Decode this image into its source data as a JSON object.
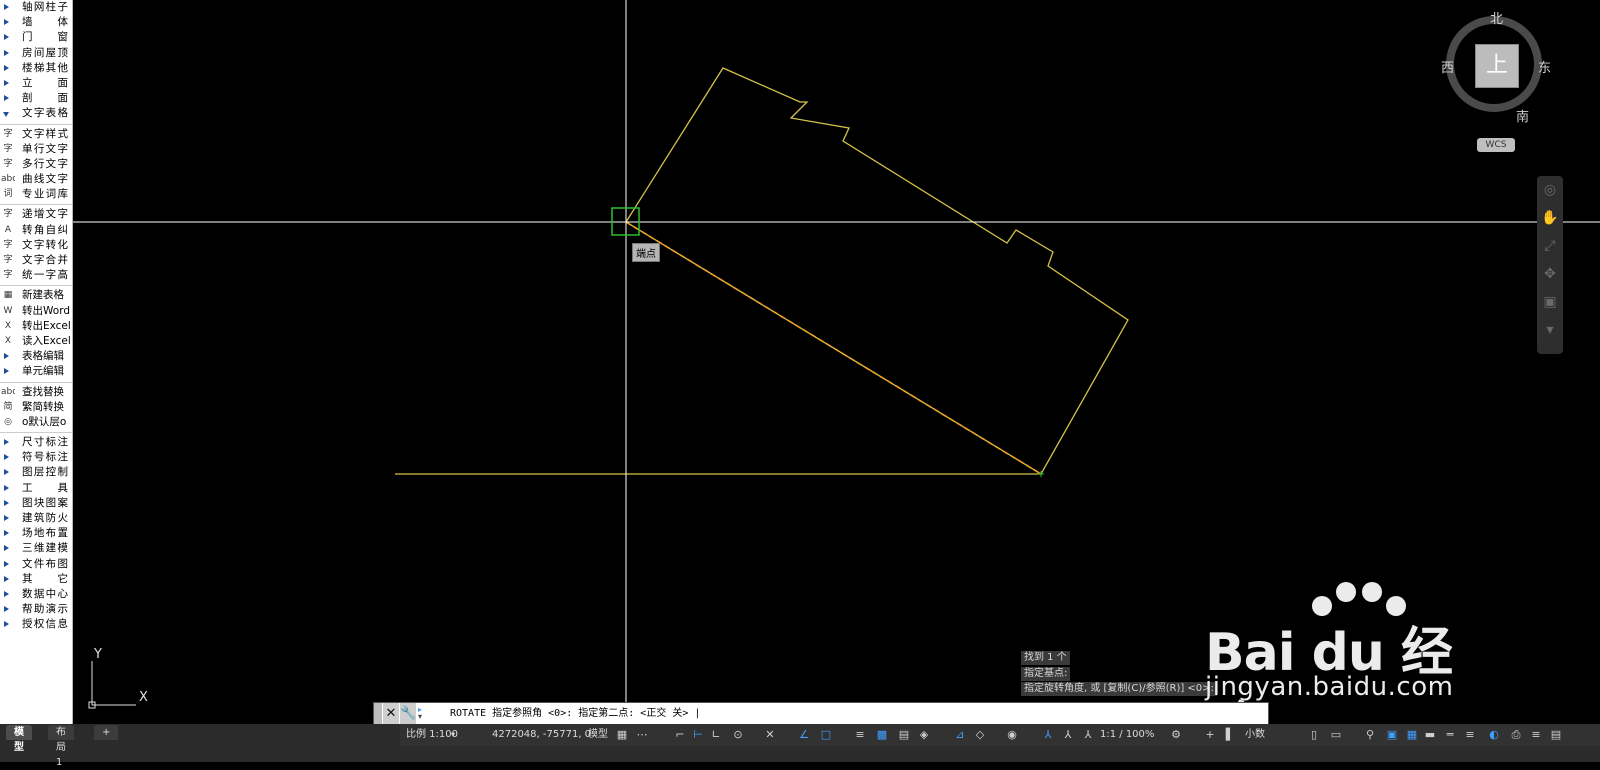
{
  "sidebar": {
    "groups_top": [
      {
        "label": "轴网柱子",
        "state": "closed"
      },
      {
        "label": "墙　体",
        "state": "closed"
      },
      {
        "label": "门　窗",
        "state": "closed"
      },
      {
        "label": "房间屋顶",
        "state": "closed"
      },
      {
        "label": "楼梯其他",
        "state": "closed"
      },
      {
        "label": "立　面",
        "state": "closed"
      },
      {
        "label": "剖　面",
        "state": "closed"
      },
      {
        "label": "文字表格",
        "state": "open"
      }
    ],
    "text_tools_1": [
      {
        "label": "文字样式",
        "icon": "text-style-icon",
        "glyph": "字"
      },
      {
        "label": "单行文字",
        "icon": "single-line-text-icon",
        "glyph": "字"
      },
      {
        "label": "多行文字",
        "icon": "multiline-text-icon",
        "glyph": "字"
      },
      {
        "label": "曲线文字",
        "icon": "curve-text-icon",
        "glyph": "abc"
      },
      {
        "label": "专业词库",
        "icon": "dictionary-icon",
        "glyph": "词"
      }
    ],
    "text_tools_2": [
      {
        "label": "递增文字",
        "icon": "increment-text-icon",
        "glyph": "字"
      },
      {
        "label": "转角自纠",
        "icon": "angle-correct-icon",
        "glyph": "A"
      },
      {
        "label": "文字转化",
        "icon": "text-convert-icon",
        "glyph": "字"
      },
      {
        "label": "文字合并",
        "icon": "text-merge-icon",
        "glyph": "字"
      },
      {
        "label": "统一字高",
        "icon": "unify-height-icon",
        "glyph": "字"
      }
    ],
    "table_tools": [
      {
        "label": "新建表格",
        "icon": "new-table-icon",
        "glyph": "▦"
      },
      {
        "label": "转出Word",
        "icon": "export-word-icon",
        "glyph": "W"
      },
      {
        "label": "转出Excel",
        "icon": "export-excel-icon",
        "glyph": "X"
      },
      {
        "label": "读入Excel",
        "icon": "import-excel-icon",
        "glyph": "X"
      },
      {
        "label": "表格编辑",
        "icon": "expand-arrow-icon",
        "glyph": ""
      },
      {
        "label": "单元编辑",
        "icon": "expand-arrow-icon",
        "glyph": ""
      }
    ],
    "misc_tools": [
      {
        "label": "查找替换",
        "icon": "find-replace-icon",
        "glyph": "abc"
      },
      {
        "label": "繁简转换",
        "icon": "trad-simp-icon",
        "glyph": "简"
      },
      {
        "label": "o默认层o",
        "icon": "default-layer-icon",
        "glyph": "◎"
      }
    ],
    "groups_bottom": [
      {
        "label": "尺寸标注"
      },
      {
        "label": "符号标注"
      },
      {
        "label": "图层控制"
      },
      {
        "label": "工　具"
      },
      {
        "label": "图块图案"
      },
      {
        "label": "建筑防火"
      },
      {
        "label": "场地布置"
      },
      {
        "label": "三维建模"
      },
      {
        "label": "文件布图"
      },
      {
        "label": "其　它"
      },
      {
        "label": "数据中心"
      },
      {
        "label": "帮助演示"
      },
      {
        "label": "授权信息",
        "icon": "license-icon"
      }
    ]
  },
  "viewcube": {
    "north": "北",
    "south": "南",
    "west": "西",
    "east": "东",
    "face": "上",
    "wcs": "WCS"
  },
  "ucs": {
    "y": "Y",
    "x": "X"
  },
  "osnap_tooltip": "端点",
  "command_history": [
    "找到 1 个",
    "指定基点:",
    "指定旋转角度, 或 [复制(C)/参照(R)] <0>:"
  ],
  "command_line": {
    "text": "ROTATE 指定参照角 <0>:  指定第二点:  <正交 关> |"
  },
  "layout_tabs": [
    "模型",
    "布局1"
  ],
  "status": {
    "scale": "比例 1:100",
    "coords": "4272048, -75771, 0",
    "model": "模型",
    "annot_scale": "1:1 / 100%",
    "units": "小数"
  },
  "watermark": {
    "brand": "Bai du 经验",
    "url": "jingyan.baidu.com"
  },
  "colors": {
    "geometry": "#d4c24a",
    "crosshair": "#ffffff",
    "snap_marker": "#2fbf2f",
    "accent": "#3ea0ff"
  }
}
